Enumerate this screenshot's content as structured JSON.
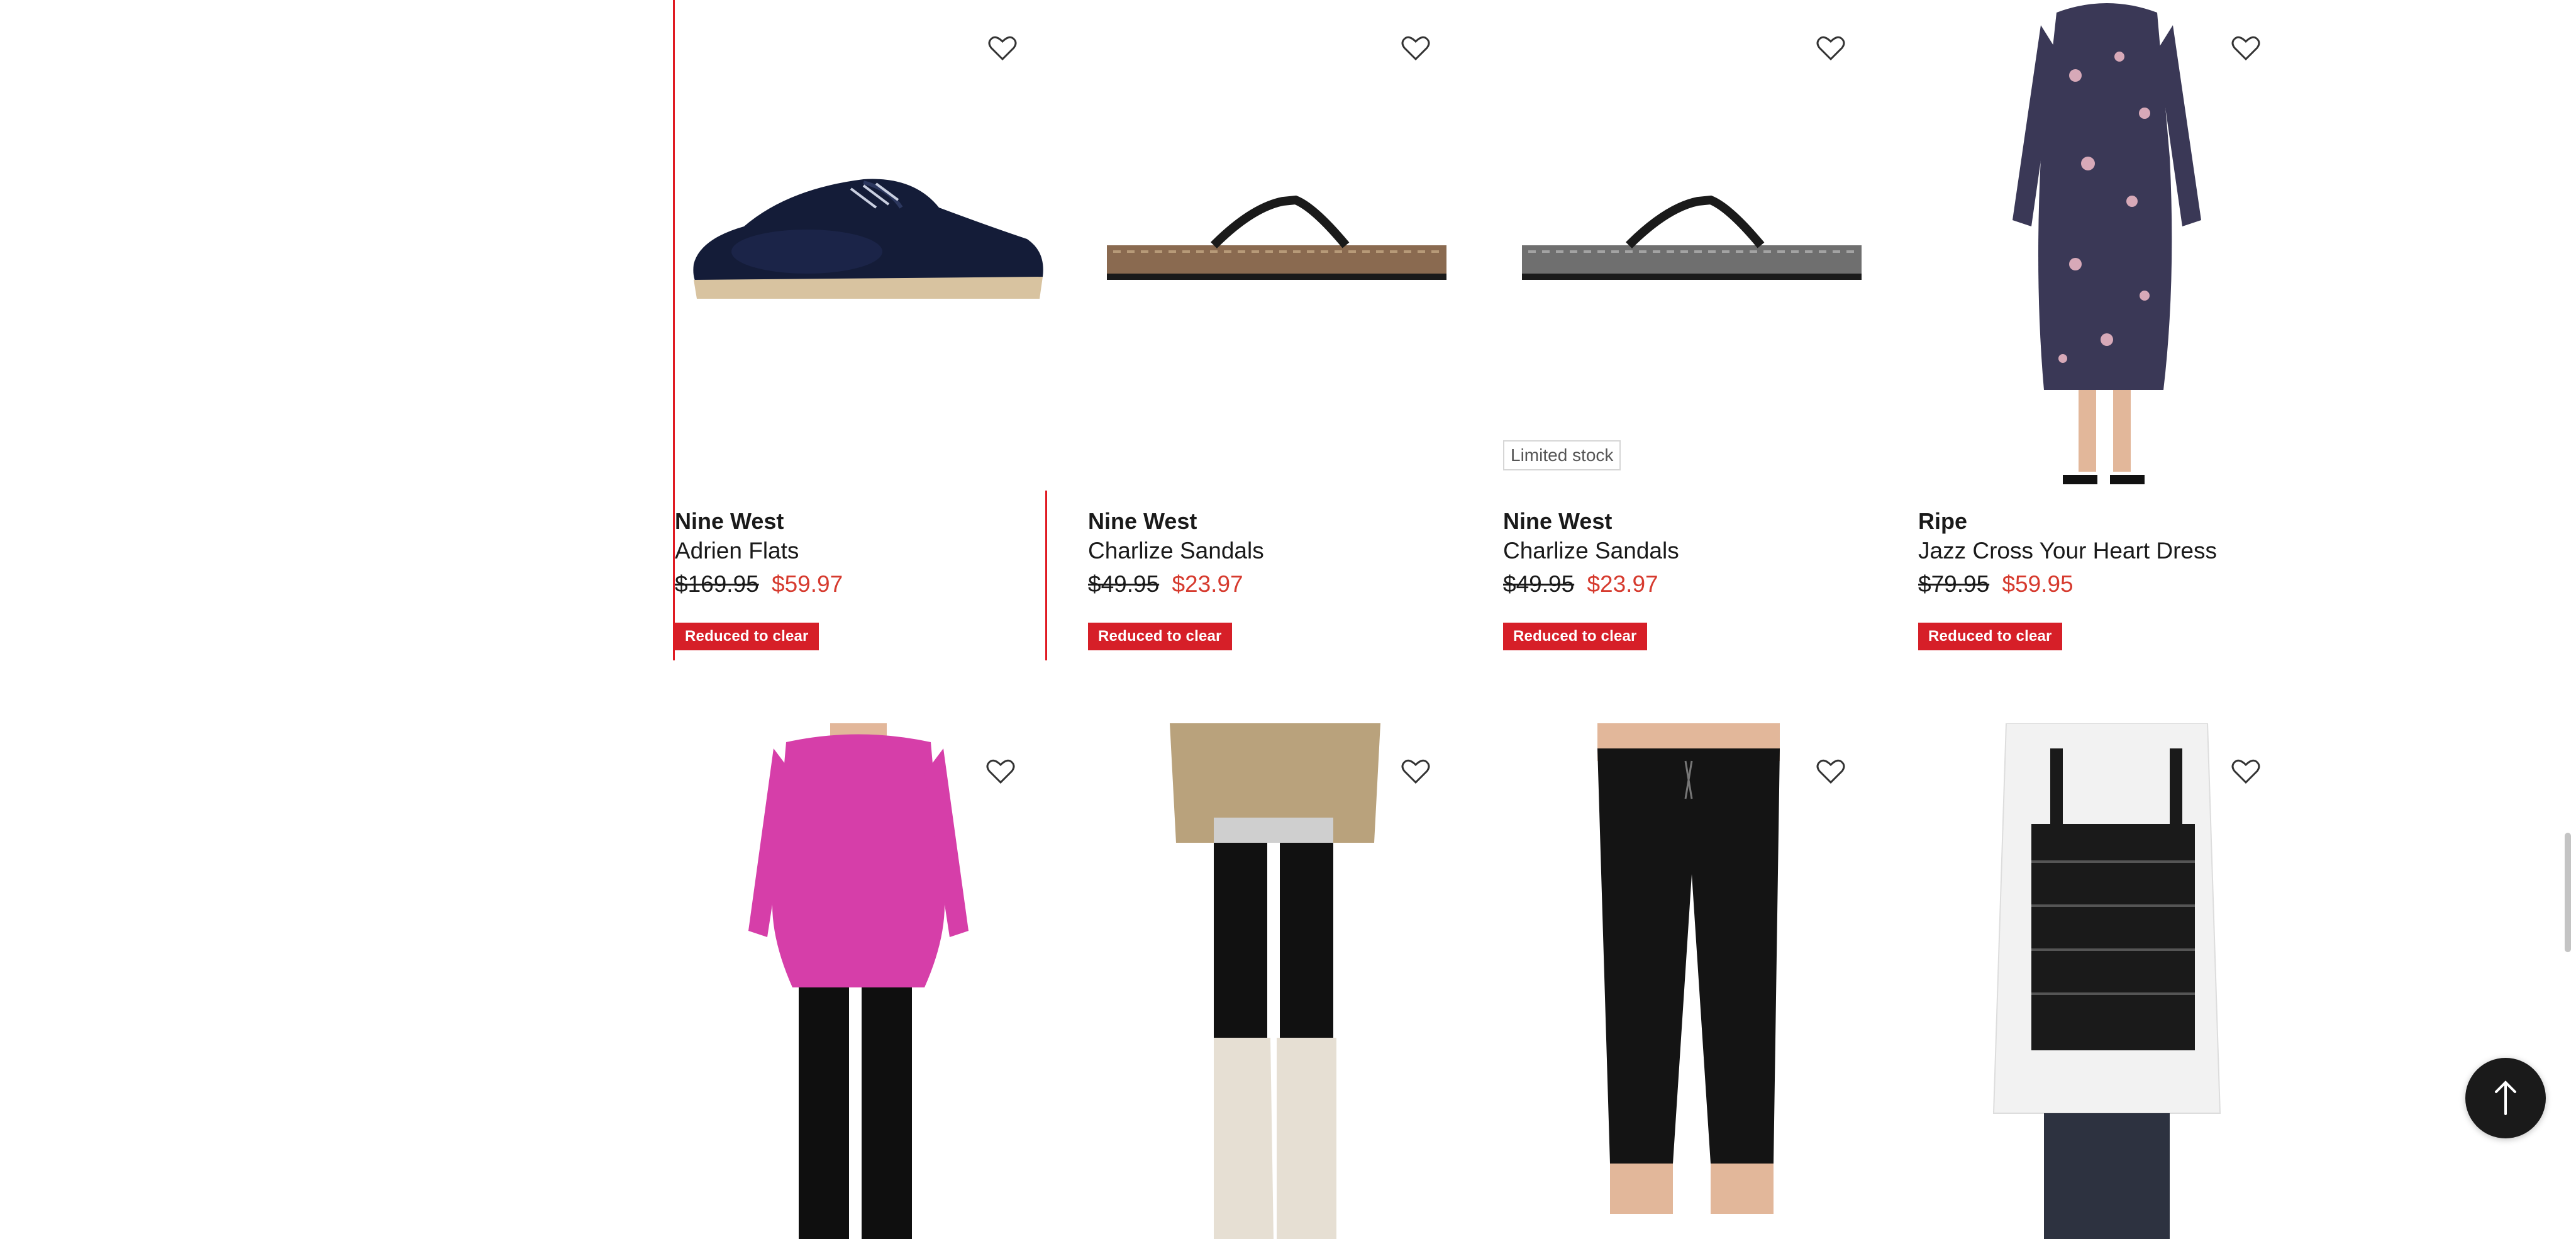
{
  "products_row1": [
    {
      "brand": "Nine West",
      "name": "Adrien Flats",
      "was": "$169.95",
      "now": "$59.97",
      "tag": "Reduced to clear",
      "badge": ""
    },
    {
      "brand": "Nine West",
      "name": "Charlize Sandals",
      "was": "$49.95",
      "now": "$23.97",
      "tag": "Reduced to clear",
      "badge": ""
    },
    {
      "brand": "Nine West",
      "name": "Charlize Sandals",
      "was": "$49.95",
      "now": "$23.97",
      "tag": "Reduced to clear",
      "badge": "Limited stock"
    },
    {
      "brand": "Ripe",
      "name": "Jazz Cross Your Heart Dress",
      "was": "$79.95",
      "now": "$59.95",
      "tag": "Reduced to clear",
      "badge": ""
    }
  ],
  "icons": {
    "wishlist": "heart-icon",
    "scroll_top": "arrow-up-icon"
  },
  "colors": {
    "sale_red": "#d61f28",
    "price_red": "#d63a2e",
    "focus_outline": "#e01a22",
    "dark_button": "#1a1a1a"
  }
}
